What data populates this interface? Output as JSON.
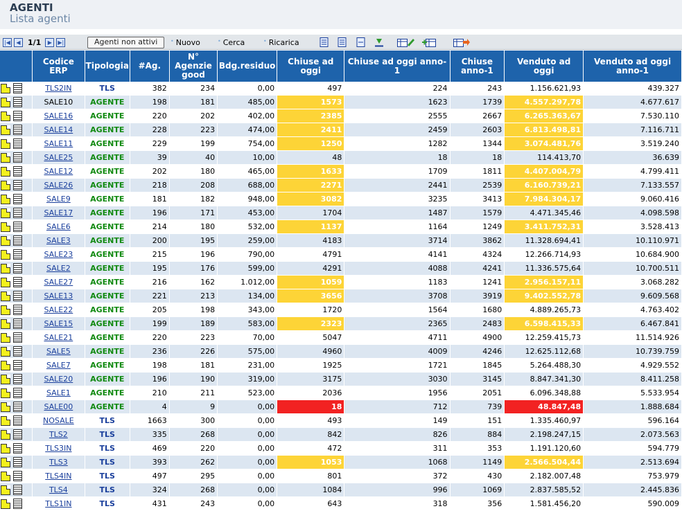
{
  "header": {
    "title": "AGENTI",
    "subtitle": "Lista agenti"
  },
  "toolbar": {
    "page": "1/1",
    "inactive_btn": "Agenti non attivi",
    "nuovo": "Nuovo",
    "cerca": "Cerca",
    "ricarica": "Ricarica"
  },
  "columns": [
    "",
    "Codice ERP",
    "Tipologia",
    "#Ag.",
    "N° Agenzie good",
    "Bdg.residuo",
    "Chiuse ad oggi",
    "Chiuse ad oggi anno-1",
    "Chiuse anno-1",
    "Venduto ad oggi",
    "Venduto ad oggi anno-1"
  ],
  "colors": {
    "highlight_yellow": "#fdd437",
    "highlight_red": "#f22222",
    "header_blue": "#1e63ab"
  },
  "rows": [
    [
      "TLS2IN",
      "TLS",
      "382",
      "234",
      "0,00",
      "497",
      "224",
      "243",
      "1.156.621,93",
      "439.327"
    ],
    [
      "SALE10",
      "AGENTE",
      "198",
      "181",
      "485,00",
      "1573",
      "1623",
      "1739",
      "4.557.297,78",
      "4.677.617"
    ],
    [
      "SALE16",
      "AGENTE",
      "220",
      "202",
      "402,00",
      "2385",
      "2555",
      "2667",
      "6.265.363,67",
      "7.530.110"
    ],
    [
      "SALE14",
      "AGENTE",
      "228",
      "223",
      "474,00",
      "2411",
      "2459",
      "2603",
      "6.813.498,81",
      "7.116.711"
    ],
    [
      "SALE11",
      "AGENTE",
      "229",
      "199",
      "754,00",
      "1250",
      "1282",
      "1344",
      "3.074.481,76",
      "3.519.240"
    ],
    [
      "SALE25",
      "AGENTE",
      "39",
      "40",
      "10,00",
      "48",
      "18",
      "18",
      "114.413,70",
      "36.639"
    ],
    [
      "SALE12",
      "AGENTE",
      "202",
      "180",
      "465,00",
      "1633",
      "1709",
      "1811",
      "4.407.004,79",
      "4.799.411"
    ],
    [
      "SALE26",
      "AGENTE",
      "218",
      "208",
      "688,00",
      "2271",
      "2441",
      "2539",
      "6.160.739,21",
      "7.133.557"
    ],
    [
      "SALE9",
      "AGENTE",
      "181",
      "182",
      "948,00",
      "3082",
      "3235",
      "3413",
      "7.984.304,17",
      "9.060.416"
    ],
    [
      "SALE17",
      "AGENTE",
      "196",
      "171",
      "453,00",
      "1704",
      "1487",
      "1579",
      "4.471.345,46",
      "4.098.598"
    ],
    [
      "SALE6",
      "AGENTE",
      "214",
      "180",
      "532,00",
      "1137",
      "1164",
      "1249",
      "3.411.752,31",
      "3.528.413"
    ],
    [
      "SALE3",
      "AGENTE",
      "200",
      "195",
      "259,00",
      "4183",
      "3714",
      "3862",
      "11.328.694,41",
      "10.110.971"
    ],
    [
      "SALE23",
      "AGENTE",
      "215",
      "196",
      "790,00",
      "4791",
      "4141",
      "4324",
      "12.266.714,93",
      "10.684.900"
    ],
    [
      "SALE2",
      "AGENTE",
      "195",
      "176",
      "599,00",
      "4291",
      "4088",
      "4241",
      "11.336.575,64",
      "10.700.511"
    ],
    [
      "SALE27",
      "AGENTE",
      "216",
      "162",
      "1.012,00",
      "1059",
      "1183",
      "1241",
      "2.956.157,11",
      "3.068.282"
    ],
    [
      "SALE13",
      "AGENTE",
      "221",
      "213",
      "134,00",
      "3656",
      "3708",
      "3919",
      "9.402.552,78",
      "9.609.568"
    ],
    [
      "SALE22",
      "AGENTE",
      "205",
      "198",
      "343,00",
      "1720",
      "1564",
      "1680",
      "4.889.265,73",
      "4.763.402"
    ],
    [
      "SALE15",
      "AGENTE",
      "199",
      "189",
      "583,00",
      "2323",
      "2365",
      "2483",
      "6.598.415,33",
      "6.467.841"
    ],
    [
      "SALE21",
      "AGENTE",
      "220",
      "223",
      "70,00",
      "5047",
      "4711",
      "4900",
      "12.259.415,73",
      "11.514.926"
    ],
    [
      "SALE5",
      "AGENTE",
      "236",
      "226",
      "575,00",
      "4960",
      "4009",
      "4246",
      "12.625.112,68",
      "10.739.759"
    ],
    [
      "SALE7",
      "AGENTE",
      "198",
      "181",
      "231,00",
      "1925",
      "1721",
      "1845",
      "5.264.488,30",
      "4.929.552"
    ],
    [
      "SALE20",
      "AGENTE",
      "196",
      "190",
      "319,00",
      "3175",
      "3030",
      "3145",
      "8.847.341,30",
      "8.411.258"
    ],
    [
      "SALE1",
      "AGENTE",
      "210",
      "211",
      "523,00",
      "2036",
      "1956",
      "2051",
      "6.096.348,88",
      "5.533.954"
    ],
    [
      "SALE00",
      "AGENTE",
      "4",
      "9",
      "0,00",
      "18",
      "712",
      "739",
      "48.847,48",
      "1.888.684"
    ],
    [
      "NOSALE",
      "TLS",
      "1663",
      "300",
      "0,00",
      "493",
      "149",
      "151",
      "1.335.460,97",
      "596.164"
    ],
    [
      "TLS2",
      "TLS",
      "335",
      "268",
      "0,00",
      "842",
      "826",
      "884",
      "2.198.247,15",
      "2.073.563"
    ],
    [
      "TLS3IN",
      "TLS",
      "469",
      "220",
      "0,00",
      "472",
      "311",
      "353",
      "1.191.120,60",
      "594.779"
    ],
    [
      "TLS3",
      "TLS",
      "393",
      "262",
      "0,00",
      "1053",
      "1068",
      "1149",
      "2.566.504,44",
      "2.513.694"
    ],
    [
      "TLS4IN",
      "TLS",
      "497",
      "295",
      "0,00",
      "801",
      "372",
      "430",
      "2.182.007,48",
      "753.979"
    ],
    [
      "TLS4",
      "TLS",
      "324",
      "268",
      "0,00",
      "1084",
      "996",
      "1069",
      "2.837.585,52",
      "2.445.836"
    ],
    [
      "TLS1IN",
      "TLS",
      "431",
      "243",
      "0,00",
      "643",
      "318",
      "356",
      "1.581.456,20",
      "590.009"
    ]
  ],
  "highlight_yellow_rows": [
    1,
    2,
    3,
    4,
    6,
    7,
    8,
    10,
    14,
    15,
    17,
    27
  ],
  "highlight_red_rows": [
    23
  ],
  "plain_code_rows": [
    1
  ]
}
